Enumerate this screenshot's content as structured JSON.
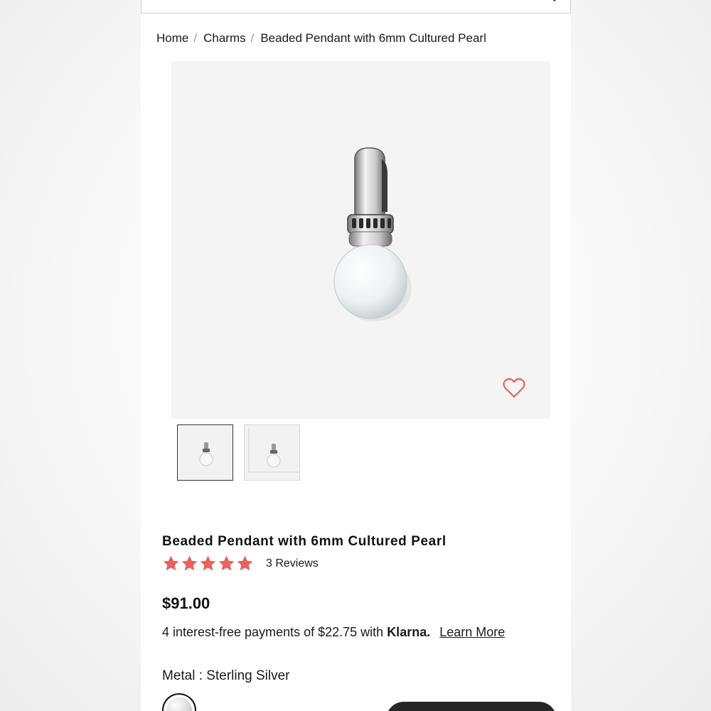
{
  "breadcrumb": {
    "items": [
      {
        "label": "Home"
      },
      {
        "label": "Charms"
      },
      {
        "label": "Beaded Pendant with 6mm Cultured Pearl"
      }
    ],
    "separator": "/"
  },
  "product": {
    "title": "Beaded Pendant with 6mm Cultured Pearl",
    "rating": 5,
    "rating_max": 5,
    "reviews_label": "3 Reviews",
    "price": "$91.00"
  },
  "financing": {
    "text": "4 interest-free payments of $22.75 with",
    "brand": "Klarna.",
    "link": "Learn More"
  },
  "options": {
    "metal_label": "Metal : Sterling Silver"
  },
  "icons": {
    "search": "search-icon",
    "favorite": "heart-outline-icon",
    "star": "star-icon"
  },
  "colors": {
    "accent": "#e8625c",
    "text": "#1a1a1a",
    "cta": "#262626"
  }
}
